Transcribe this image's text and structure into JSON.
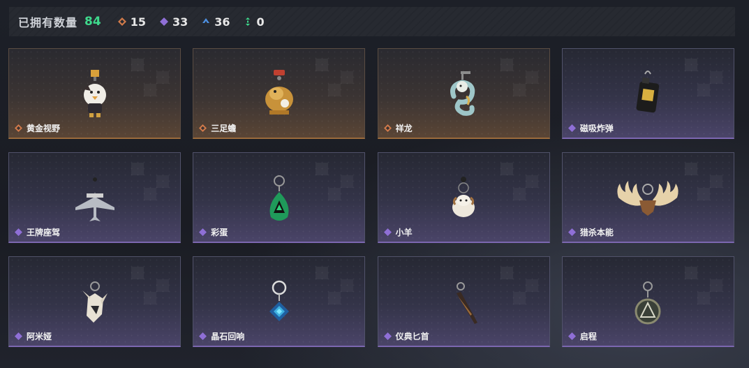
{
  "stats": {
    "label": "已拥有数量",
    "total": "84",
    "items": [
      {
        "icon": "gold-rarity-icon",
        "value": "15",
        "color": "#d27a4a"
      },
      {
        "icon": "purple-rarity-icon",
        "value": "33",
        "color": "#8f6fd6"
      },
      {
        "icon": "blue-rarity-icon",
        "value": "36",
        "color": "#4d8fe0"
      },
      {
        "icon": "green-rarity-icon",
        "value": "0",
        "color": "#3ed98c"
      }
    ]
  },
  "colors": {
    "total_green": "#3ed98c",
    "gold": "#d27a4a",
    "purple": "#8f6fd6"
  },
  "cards": [
    {
      "name": "黄金视野",
      "rarity": "gold",
      "icon": "chick-charm-icon"
    },
    {
      "name": "三足蟾",
      "rarity": "gold",
      "icon": "golden-toad-charm-icon"
    },
    {
      "name": "祥龙",
      "rarity": "gold",
      "icon": "dragon-charm-icon"
    },
    {
      "name": "磁吸炸弹",
      "rarity": "purple",
      "icon": "bomb-charm-icon"
    },
    {
      "name": "王牌座驾",
      "rarity": "purple",
      "icon": "jet-charm-icon"
    },
    {
      "name": "彩蛋",
      "rarity": "purple",
      "icon": "green-egg-charm-icon"
    },
    {
      "name": "小羊",
      "rarity": "purple",
      "icon": "sheep-charm-icon"
    },
    {
      "name": "猎杀本能",
      "rarity": "purple",
      "icon": "antler-charm-icon"
    },
    {
      "name": "阿米娅",
      "rarity": "purple",
      "icon": "fox-charm-icon"
    },
    {
      "name": "晶石回响",
      "rarity": "purple",
      "icon": "crystal-charm-icon"
    },
    {
      "name": "仪典匕首",
      "rarity": "purple",
      "icon": "dagger-charm-icon"
    },
    {
      "name": "启程",
      "rarity": "purple",
      "icon": "medallion-charm-icon"
    }
  ]
}
